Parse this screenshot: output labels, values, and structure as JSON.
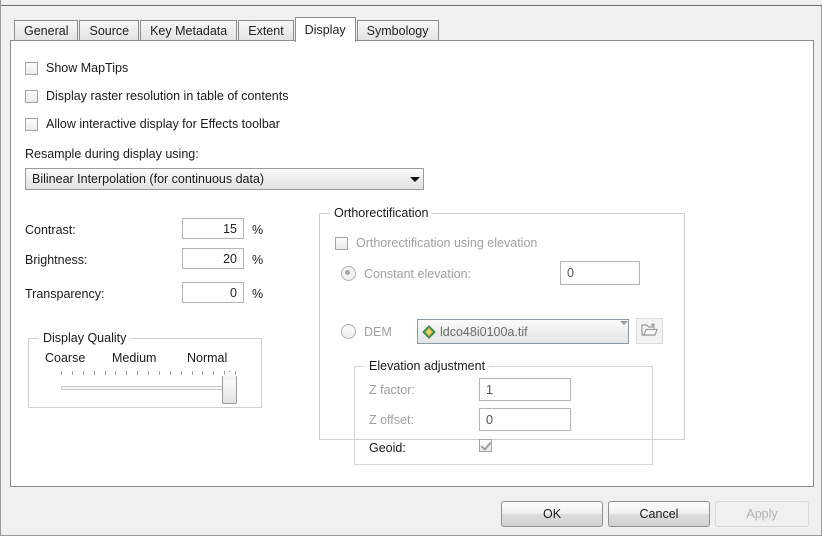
{
  "tabs": [
    {
      "label": "General",
      "active": false
    },
    {
      "label": "Source",
      "active": false
    },
    {
      "label": "Key Metadata",
      "active": false
    },
    {
      "label": "Extent",
      "active": false
    },
    {
      "label": "Display",
      "active": true
    },
    {
      "label": "Symbology",
      "active": false
    }
  ],
  "display": {
    "checkboxes": [
      {
        "label": "Show MapTips",
        "checked": false
      },
      {
        "label": "Display raster resolution in table of contents",
        "checked": false
      },
      {
        "label": "Allow interactive display for Effects toolbar",
        "checked": false
      }
    ],
    "resample": {
      "label": "Resample during display using:",
      "value": "Bilinear Interpolation (for continuous data)"
    },
    "adjust": {
      "contrast_label": "Contrast:",
      "contrast_value": "15",
      "brightness_label": "Brightness:",
      "brightness_value": "20",
      "transparency_label": "Transparency:",
      "transparency_value": "0",
      "unit": "%"
    },
    "display_quality": {
      "title": "Display Quality",
      "ticks_coarse": "Coarse",
      "ticks_medium": "Medium",
      "ticks_normal": "Normal",
      "tick_count": 17,
      "value_position_pct": 96
    }
  },
  "orthorectification": {
    "title": "Orthorectification",
    "enable_label": "Orthorectification using elevation",
    "enable_checked": false,
    "constant_label": "Constant elevation:",
    "constant_selected": true,
    "constant_value": "0",
    "dem_label": "DEM",
    "dem_selected": false,
    "dem_value": "ldco48i0100a.tif",
    "browse_icon": "open-folder-add-icon",
    "elevation_adjustment": {
      "title": "Elevation adjustment",
      "zfactor_label": "Z factor:",
      "zfactor_value": "1",
      "zoffset_label": "Z offset:",
      "zoffset_value": "0",
      "geoid_label": "Geoid:",
      "geoid_checked": true
    }
  },
  "footer": {
    "ok": "OK",
    "cancel": "Cancel",
    "apply": "Apply",
    "apply_enabled": false
  },
  "colors": {
    "window_bg": "#f0f0f0",
    "panel_bg": "#ffffff",
    "border": "#8c8c8c",
    "disabled_text": "#a0a0a0"
  }
}
